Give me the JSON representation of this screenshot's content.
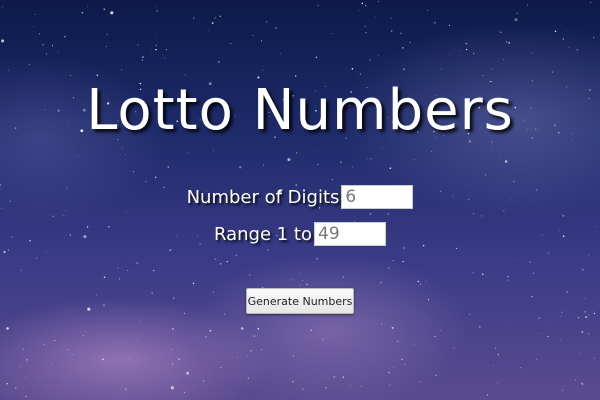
{
  "title": "Lotto Numbers",
  "digits": {
    "label": "Number of Digits",
    "value": "6"
  },
  "range": {
    "label": "Range 1 to",
    "value": "49"
  },
  "generate_button": {
    "label": "Generate Numbers"
  },
  "colors": {
    "text": "#ffffff",
    "background": "#1f2c6c"
  }
}
